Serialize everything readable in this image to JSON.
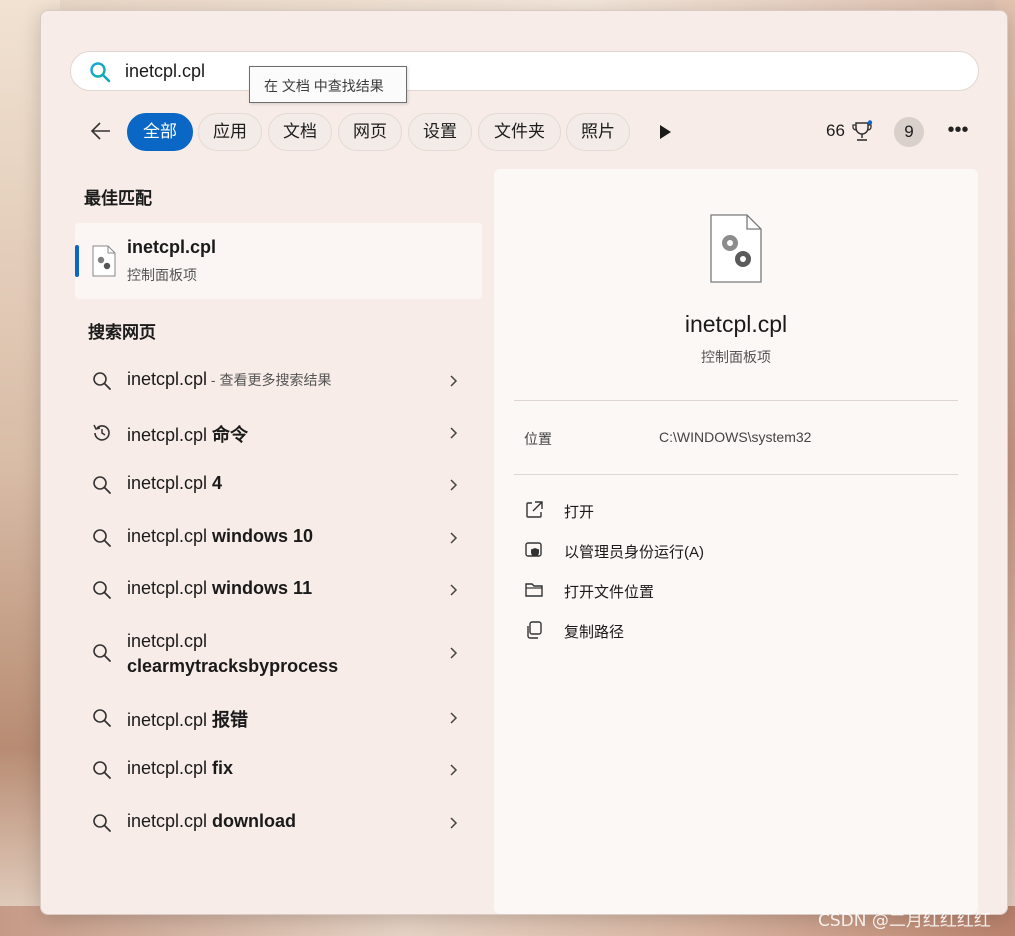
{
  "search": {
    "value": "inetcpl.cpl"
  },
  "tooltip": {
    "text": "在 文档 中查找结果"
  },
  "filters": [
    "全部",
    "应用",
    "文档",
    "网页",
    "设置",
    "文件夹",
    "照片"
  ],
  "rewards": {
    "points": "66",
    "badge_count": "9"
  },
  "best_match": {
    "heading": "最佳匹配",
    "title": "inetcpl.cpl",
    "subtitle": "控制面板项"
  },
  "web_search": {
    "heading": "搜索网页",
    "results": [
      {
        "prefix": "inetcpl.cpl",
        "bold": "",
        "suffix": " - 查看更多搜索结果",
        "icon": "search-icon"
      },
      {
        "prefix": "inetcpl.cpl ",
        "bold": "命令",
        "suffix": "",
        "icon": "history-icon"
      },
      {
        "prefix": "inetcpl.cpl ",
        "bold": "4",
        "suffix": "",
        "icon": "search-icon"
      },
      {
        "prefix": "inetcpl.cpl ",
        "bold": "windows 10",
        "suffix": "",
        "icon": "search-icon"
      },
      {
        "prefix": "inetcpl.cpl ",
        "bold": "windows 11",
        "suffix": "",
        "icon": "search-icon"
      },
      {
        "prefix": "inetcpl.cpl",
        "bold": "clearmytracksbyprocess",
        "suffix": "",
        "icon": "search-icon"
      },
      {
        "prefix": "inetcpl.cpl ",
        "bold": "报错",
        "suffix": "",
        "icon": "search-icon"
      },
      {
        "prefix": "inetcpl.cpl ",
        "bold": "fix",
        "suffix": "",
        "icon": "search-icon"
      },
      {
        "prefix": "inetcpl.cpl ",
        "bold": "download",
        "suffix": "",
        "icon": "search-icon"
      }
    ]
  },
  "detail": {
    "title": "inetcpl.cpl",
    "subtitle": "控制面板项",
    "location_label": "位置",
    "location_value": "C:\\WINDOWS\\system32",
    "actions": [
      "打开",
      "以管理员身份运行(A)",
      "打开文件位置",
      "复制路径"
    ]
  },
  "watermark": "CSDN @二月红红红红",
  "colors": {
    "accent": "#0a67c6",
    "panel": "#f7ece7"
  }
}
